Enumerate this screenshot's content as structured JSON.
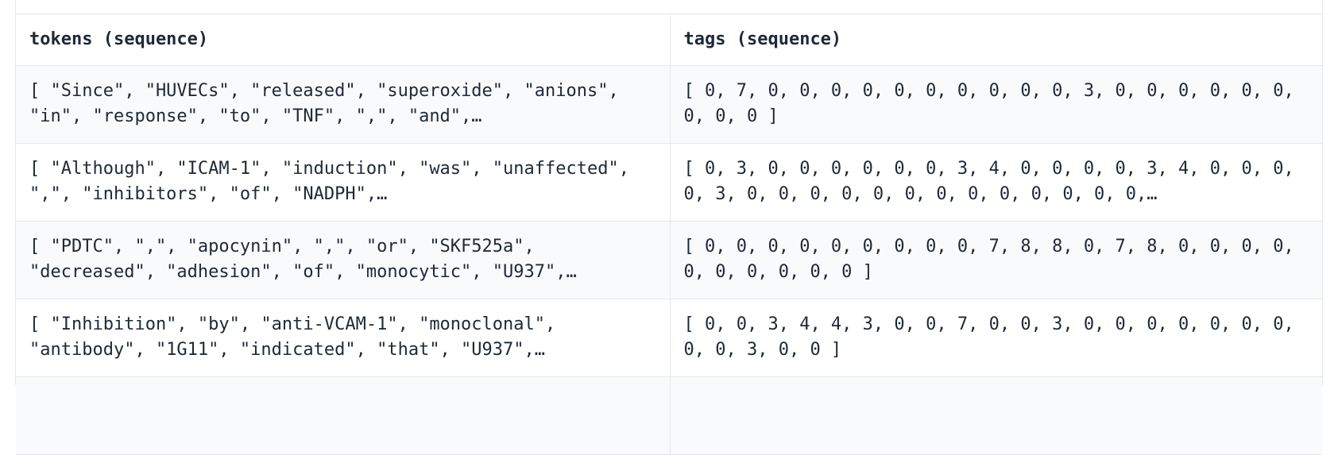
{
  "table": {
    "columns": [
      {
        "label": "tokens (sequence)"
      },
      {
        "label": "tags (sequence)"
      }
    ],
    "rows": [
      {
        "tokens": "[ \"Since\", \"HUVECs\", \"released\", \"superoxide\", \"anions\", \"in\", \"response\", \"to\", \"TNF\", \",\", \"and\",…",
        "tags": "[ 0, 7, 0, 0, 0, 0, 0, 0, 0, 0, 0, 0, 3, 0, 0, 0, 0, 0, 0, 0, 0, 0 ]"
      },
      {
        "tokens": "[ \"Although\", \"ICAM-1\", \"induction\", \"was\", \"unaffected\", \",\", \"inhibitors\", \"of\", \"NADPH\",…",
        "tags": "[ 0, 3, 0, 0, 0, 0, 0, 0, 3, 4, 0, 0, 0, 0, 3, 4, 0, 0, 0, 0, 3, 0, 0, 0, 0, 0, 0, 0, 0, 0, 0, 0, 0, 0,…"
      },
      {
        "tokens": "[ \"PDTC\", \",\", \"apocynin\", \",\", \"or\", \"SKF525a\", \"decreased\", \"adhesion\", \"of\", \"monocytic\", \"U937\",…",
        "tags": "[ 0, 0, 0, 0, 0, 0, 0, 0, 0, 7, 8, 8, 0, 7, 8, 0, 0, 0, 0, 0, 0, 0, 0, 0, 0 ]"
      },
      {
        "tokens": "[ \"Inhibition\", \"by\", \"anti-VCAM-1\", \"monoclonal\", \"antibody\", \"1G11\", \"indicated\", \"that\", \"U937\",…",
        "tags": "[ 0, 0, 3, 4, 4, 3, 0, 0, 7, 0, 0, 3, 0, 0, 0, 0, 0, 0, 0, 0, 0, 3, 0, 0 ]"
      },
      {
        "tokens": "",
        "tags": ""
      }
    ]
  }
}
